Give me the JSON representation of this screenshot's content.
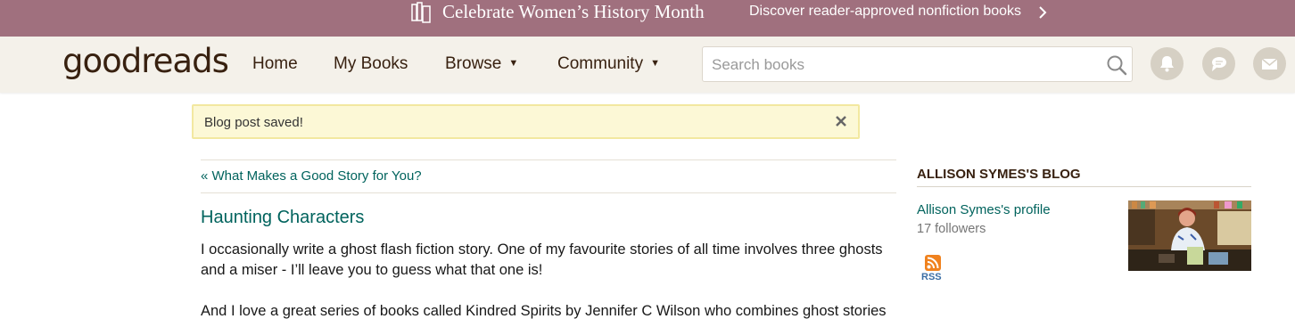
{
  "promo": {
    "title": "Celebrate Women’s History Month",
    "link_text": "Discover reader-approved nonfiction books",
    "icon": "books-icon",
    "bg_color": "#a0707e"
  },
  "header": {
    "logo_good": "good",
    "logo_reads": "reads",
    "nav": {
      "home": "Home",
      "my_books": "My Books",
      "browse": "Browse",
      "community": "Community"
    },
    "search_placeholder": "Search books",
    "icons": [
      "notifications-bell-icon",
      "discussions-chat-icon",
      "messages-mail-icon"
    ]
  },
  "notice": {
    "text": "Blog post saved!"
  },
  "post": {
    "prev_link": "« What Makes a Good Story for You?",
    "title": "Haunting Characters",
    "paragraph1": "I occasionally write a ghost flash fiction story. One of my favourite stories of all time involves three ghosts and a miser - I’ll leave you to guess what that one is!",
    "paragraph2": "And I love a great series of books called Kindred Spirits by Jennifer C Wilson who combines ghost stories"
  },
  "sidebar": {
    "heading": "ALLISON SYMES'S BLOG",
    "profile_link": "Allison Symes's profile",
    "followers": "17 followers",
    "rss_label": "RSS"
  },
  "colors": {
    "link": "#00635d",
    "header_bg": "#f4f1ea",
    "brown": "#382110",
    "notice_bg": "#fcf8d6"
  }
}
